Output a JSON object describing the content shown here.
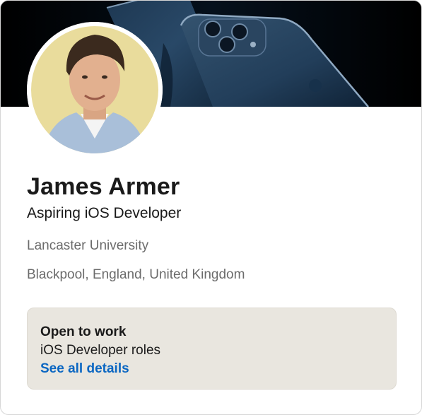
{
  "profile": {
    "name": "James Armer",
    "headline": "Aspiring iOS Developer",
    "school": "Lancaster University",
    "location": "Blackpool, England, United Kingdom"
  },
  "open_to_work": {
    "title": "Open to work",
    "roles": "iOS Developer roles",
    "link_label": "See all details"
  },
  "icons": {
    "banner": "iphone-banner-image",
    "avatar": "profile-photo"
  },
  "colors": {
    "link": "#0a66c2",
    "open_to_work_bg": "#e9e6df",
    "secondary_text": "#6b6b6b"
  }
}
